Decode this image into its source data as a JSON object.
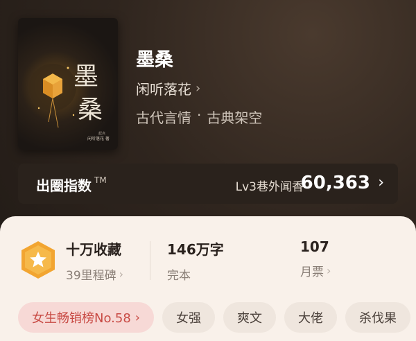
{
  "book": {
    "title": "墨桑",
    "author": "闲听落花",
    "genre_primary": "古代言情",
    "genre_separator": "·",
    "genre_secondary": "古典架空",
    "cover_title": "墨桑",
    "cover_author": "闲听落花 著",
    "cover_publisher": "起点中文网"
  },
  "circle_index": {
    "label": "出圈指数",
    "tm": "TM",
    "level": "Lv3巷外闻香",
    "score": "60,363"
  },
  "stats": {
    "collection": {
      "main": "十万收藏",
      "sub": "39里程碑"
    },
    "words": {
      "main": "146万字",
      "sub": "完本"
    },
    "tickets": {
      "main": "107",
      "sub": "月票"
    }
  },
  "tags": {
    "rank": "女生畅销榜No.58",
    "items": [
      "女强",
      "爽文",
      "大佬",
      "杀伐果"
    ]
  },
  "colors": {
    "header_bg": "#2f251e",
    "panel_bg": "#f9f1ea",
    "badge_orange": "#f2a531",
    "rank_tag_bg": "#f7d9d6",
    "rank_tag_text": "#c84a44"
  },
  "icons": {
    "chevron": "chevron-right-icon",
    "badge": "star-hexagon-badge-icon"
  }
}
